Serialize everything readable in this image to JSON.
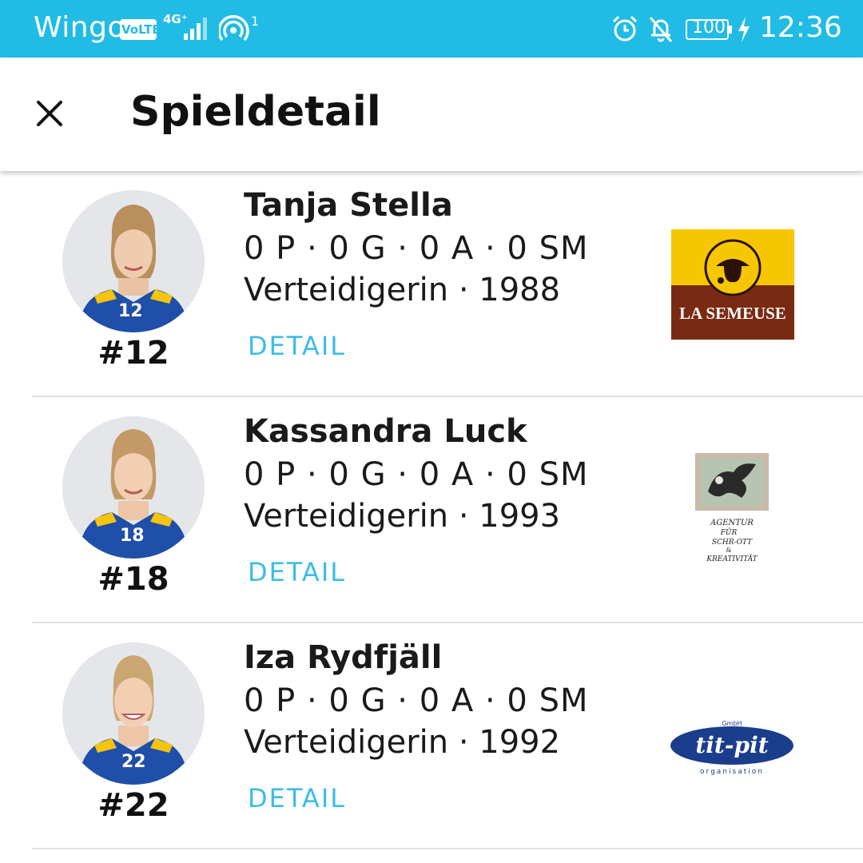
{
  "status_bar": {
    "carrier": "Wingo",
    "volte": "VoLTE",
    "network": "4G⁺",
    "hotspot_count": "1",
    "battery": "100",
    "time": "12:36",
    "icons": [
      "volte-icon",
      "signal-icon",
      "hotspot-icon",
      "alarm-icon",
      "bell-off-icon",
      "battery-icon",
      "charging-icon"
    ]
  },
  "appbar": {
    "close_icon": "close-icon",
    "title": "Spieldetail"
  },
  "players": [
    {
      "name": "Tanja Stella",
      "stats": "0 P · 0 G · 0 A · 0 SM",
      "role": "Verteidigerin · 1988",
      "jersey": "#12",
      "shirt_number": "12",
      "detail_label": "DETAIL",
      "sponsor": "LA SEMEUSE"
    },
    {
      "name": "Kassandra Luck",
      "stats": "0 P · 0 G · 0 A · 0 SM",
      "role": "Verteidigerin · 1993",
      "jersey": "#18",
      "shirt_number": "18",
      "detail_label": "DETAIL",
      "sponsor_lines": [
        "AGENTUR",
        "FÜR",
        "SCHR-OTT",
        "&",
        "KREATIVITÄT"
      ]
    },
    {
      "name": "Iza Rydfjäll",
      "stats": "0 P · 0 G · 0 A · 0 SM",
      "role": "Verteidigerin · 1992",
      "jersey": "#22",
      "shirt_number": "22",
      "detail_label": "DETAIL",
      "sponsor": "tit-pit",
      "sponsor_top": "GmbH",
      "sponsor_bottom": "organisation"
    }
  ],
  "colors": {
    "status_bar": "#20bce6",
    "accent_link": "#3bbde6",
    "jersey_blue": "#1f4fa8",
    "jersey_yellow": "#f4c40f",
    "sponsor_yellow": "#f6c700",
    "sponsor_brown": "#7a2a12",
    "titpit_blue": "#1a3d8c"
  }
}
